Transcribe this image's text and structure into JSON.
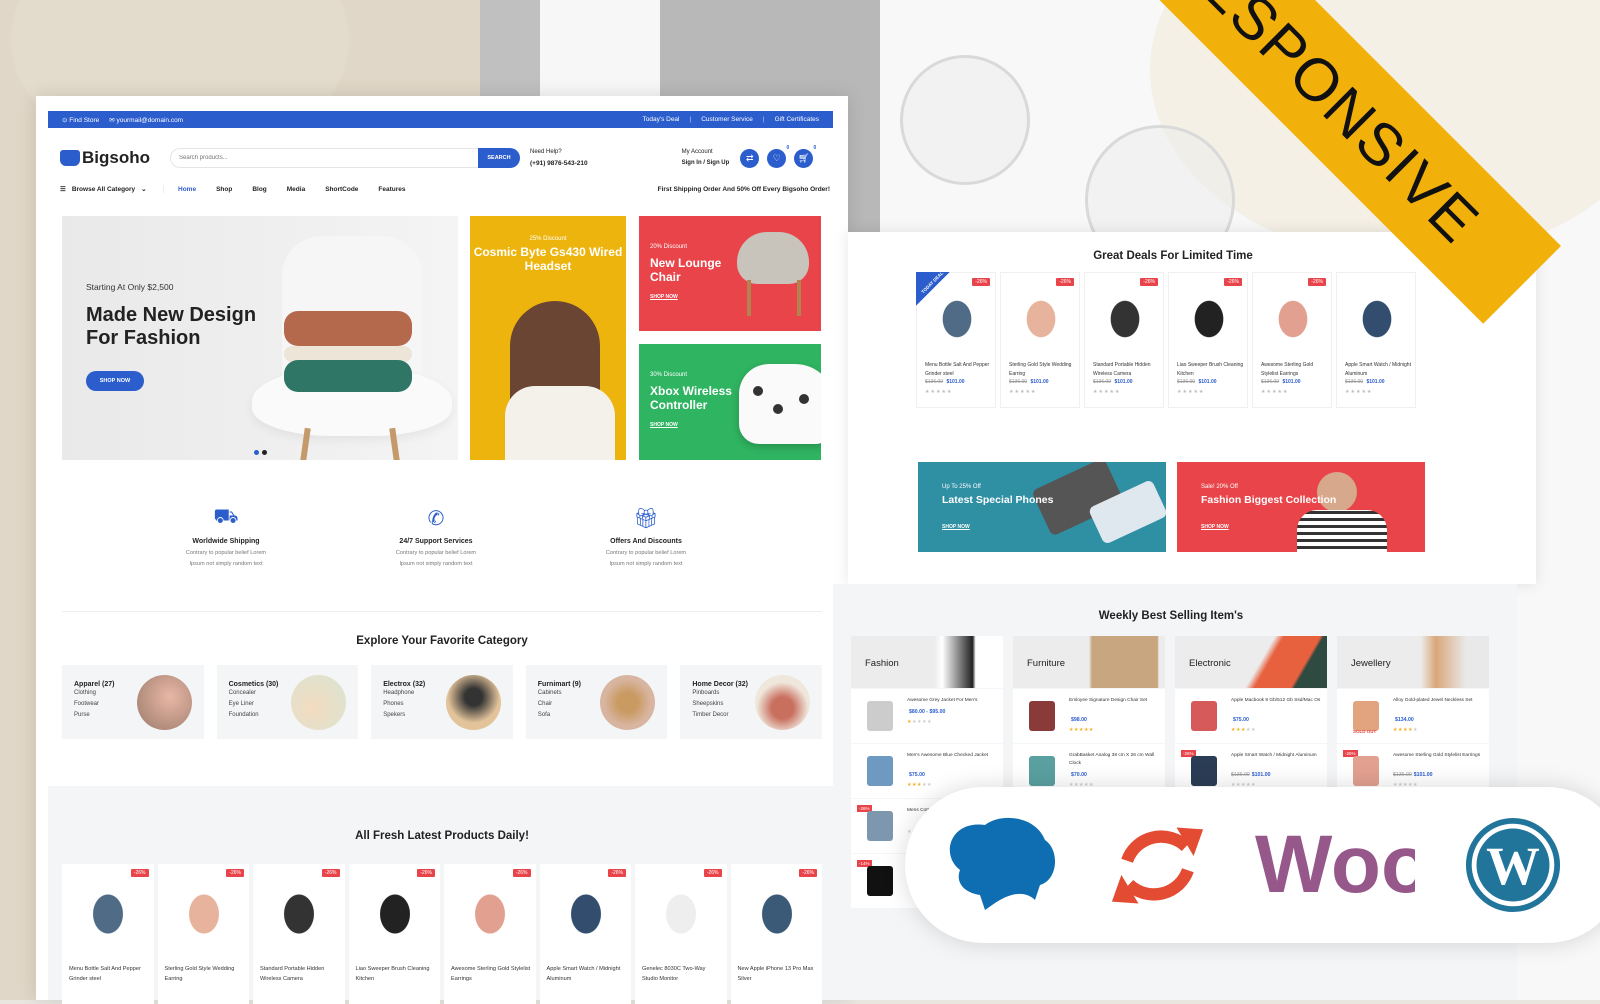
{
  "ribbon": {
    "text": "RESPONSIVE"
  },
  "topbar": {
    "find_store": "Find Store",
    "email": "yourmail@domain.com",
    "links": [
      "Today's Deal",
      "Customer Service",
      "Gift Certificates"
    ]
  },
  "header": {
    "logo": "Bigsoho",
    "search_placeholder": "Search products...",
    "search_button": "SEARCH",
    "help_label": "Need Help?",
    "help_phone": "(+91) 9876-543-210",
    "account_label": "My Account",
    "account_action": "Sign In / Sign Up",
    "wishlist_count": "0",
    "cart_count": "0"
  },
  "nav": {
    "browse": "Browse All Category",
    "items": [
      "Home",
      "Shop",
      "Blog",
      "Media",
      "ShortCode",
      "Features"
    ],
    "active": "Home",
    "promo": "First Shipping Order And 50% Off Every Bigsoho Order!"
  },
  "hero": {
    "subtitle": "Starting At Only $2,500",
    "title": "Made New Design For Fashion",
    "button": "SHOP NOW",
    "slide_count": 2,
    "active_slide": 1
  },
  "promos": [
    {
      "discount": "25% Discount",
      "title": "Cosmic Byte Gs430 Wired Headset",
      "color": "#ecb40d"
    },
    {
      "discount": "20% Discount",
      "title": "New Lounge Chair",
      "link": "SHOP NOW",
      "color": "#e8444a"
    },
    {
      "discount": "30% Discount",
      "title": "Xbox Wireless Controller",
      "link": "SHOP NOW",
      "color": "#2fb461"
    }
  ],
  "features": [
    {
      "icon": "truck-icon",
      "title": "Worldwide Shipping",
      "text1": "Contrary to popular belief Lorem",
      "text2": "Ipsum not simply random text"
    },
    {
      "icon": "phone-support-icon",
      "title": "24/7 Support Services",
      "text1": "Contrary to popular belief Lorem",
      "text2": "Ipsum not simply random text"
    },
    {
      "icon": "gift-discount-icon",
      "title": "Offers And Discounts",
      "text1": "Contrary to popular belief Lorem",
      "text2": "Ipsum not simply random text"
    }
  ],
  "categories_title": "Explore Your Favorite Category",
  "categories": [
    {
      "name": "Apparel (27)",
      "subs": [
        "Clothing",
        "Footwear",
        "Purse"
      ]
    },
    {
      "name": "Cosmetics (30)",
      "subs": [
        "Concealer",
        "Eye Liner",
        "Foundation"
      ]
    },
    {
      "name": "Electrox (32)",
      "subs": [
        "Headphone",
        "Phones",
        "Spekers"
      ]
    },
    {
      "name": "Furnimart (9)",
      "subs": [
        "Cabinets",
        "Chair",
        "Sofa"
      ]
    },
    {
      "name": "Home Decor (32)",
      "subs": [
        "Pinboards",
        "Sheepskins",
        "Timber Decor"
      ]
    }
  ],
  "latest_title": "All Fresh Latest Products Daily!",
  "latest_products": [
    {
      "badge": "-26%",
      "name": "Menu Bottle Salt And Pepper Grinder steel"
    },
    {
      "badge": "-26%",
      "name": "Sterling Gold Style Wedding Earring"
    },
    {
      "badge": "-26%",
      "name": "Standard Portable Hidden Wireless Camera"
    },
    {
      "badge": "-26%",
      "name": "Liao Sweeper Brush Cleaning Kitchen"
    },
    {
      "badge": "-26%",
      "name": "Awesome Sterling Gold Stylelist Earrings"
    },
    {
      "badge": "-26%",
      "name": "Apple Smart Watch / Midnight Aluminum"
    },
    {
      "badge": "-26%",
      "name": "Genelec 8030C Two-Way Studio Monitor"
    },
    {
      "badge": "-26%",
      "name": "New Apple iPhone 13 Pro Max Silver"
    }
  ],
  "deals_title": "Great Deals For Limited Time",
  "today_deal": "TODAY DEAL",
  "deals": [
    {
      "badge": "-26%",
      "name": "Menu Bottle Salt And Pepper Grinder steel",
      "old": "$136.00",
      "price": "$101.00"
    },
    {
      "badge": "-26%",
      "name": "Sterling Gold Style Wedding Earring",
      "old": "$136.00",
      "price": "$101.00"
    },
    {
      "badge": "-26%",
      "name": "Standard Portable Hidden Wireless Camera",
      "old": "$136.00",
      "price": "$101.00"
    },
    {
      "badge": "-26%",
      "name": "Liao Sweeper Brush Cleaning Kitchen",
      "old": "$136.00",
      "price": "$101.00"
    },
    {
      "badge": "-26%",
      "name": "Awesome Sterling Gold Stylelist Earrings",
      "old": "$136.00",
      "price": "$101.00"
    },
    {
      "badge": "",
      "name": "Apple Smart Watch / Midnight Aluminum",
      "old": "$136.00",
      "price": "$101.00"
    }
  ],
  "banners": [
    {
      "discount": "Up To 25% Off",
      "title": "Latest Special Phones",
      "link": "SHOP NOW",
      "color": "#2f8fa3"
    },
    {
      "discount": "Sale! 20% Off",
      "title": "Fashion Biggest Collection",
      "link": "SHOP NOW",
      "color": "#e8444a"
    }
  ],
  "weekly_title": "Weekly Best Selling Item's",
  "weekly": [
    {
      "head": "Fashion",
      "items": [
        {
          "name": "Awesome Grey Jacket For Men's",
          "price": "$80.00 - $95.00",
          "old": "",
          "rating": 1
        },
        {
          "name": "Men's Awesome Blue Checked Jacket",
          "price": "$75.00",
          "old": "",
          "rating": 3
        },
        {
          "name": "Mens Cotton Half Sleeve T-Shirt",
          "price": "",
          "old": "",
          "rating": 0,
          "badge": "-26%"
        },
        {
          "name": "",
          "price": "",
          "old": "",
          "rating": 0,
          "badge": "-14%"
        }
      ]
    },
    {
      "head": "Furniture",
      "items": [
        {
          "name": "Emloyee Signature Design Chair Set",
          "price": "$98.00",
          "old": "",
          "rating": 5
        },
        {
          "name": "GrabBasket Analog 38 cm X 26 cm Wall Clock",
          "price": "$70.00",
          "old": "",
          "rating": 0
        }
      ]
    },
    {
      "head": "Electronic",
      "items": [
        {
          "name": "Apple Macbook 8 Gb/512 Gb Ssd/Mac Os",
          "price": "$75.00",
          "old": "",
          "rating": 3
        },
        {
          "name": "Apple Smart Watch / Midnight Aluminum",
          "price": "$101.00",
          "old": "$136.00",
          "rating": 0,
          "badge": "-26%"
        }
      ]
    },
    {
      "head": "Jewellery",
      "items": [
        {
          "name": "Alloy Gold-plated Jewel Neckless Set",
          "price": "$134.00",
          "old": "",
          "rating": 4,
          "soldout": "SOLD OUT"
        },
        {
          "name": "Awesome Sterling Gold Stylelist Earrings",
          "price": "$101.00",
          "old": "$136.00",
          "rating": 0,
          "badge": "-26%"
        }
      ]
    }
  ],
  "platform_logos": [
    "chef-hat-logo-icon",
    "sync-icon",
    "woocommerce-logo-icon",
    "wordpress-logo-icon"
  ],
  "platform_logo_text": {
    "woo": "Woo"
  }
}
